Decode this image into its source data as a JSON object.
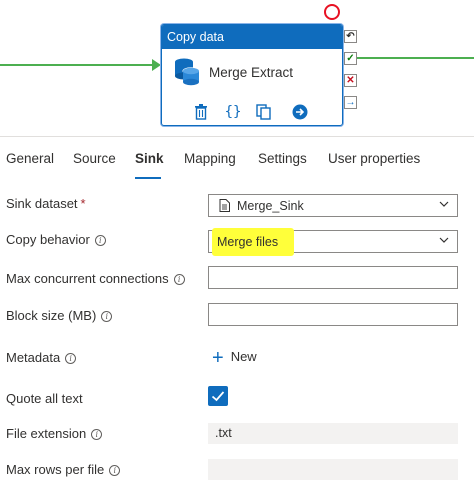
{
  "activity": {
    "type_label": "Copy data",
    "name": "Merge Extract",
    "action_icons": [
      "delete-icon",
      "code-icon",
      "copy-icon",
      "arrow-right-circle-icon"
    ],
    "side_icons": [
      "redo-icon",
      "success-check-icon",
      "failure-x-icon",
      "completion-arrow-icon"
    ]
  },
  "tabs": [
    {
      "label": "General",
      "active": false
    },
    {
      "label": "Source",
      "active": false
    },
    {
      "label": "Sink",
      "active": true
    },
    {
      "label": "Mapping",
      "active": false
    },
    {
      "label": "Settings",
      "active": false
    },
    {
      "label": "User properties",
      "active": false
    }
  ],
  "form": {
    "sink_dataset": {
      "label": "Sink dataset",
      "required_mark": "*",
      "value": "Merge_Sink"
    },
    "copy_behavior": {
      "label": "Copy behavior",
      "value": "Merge files"
    },
    "max_concurrent": {
      "label": "Max concurrent connections",
      "value": ""
    },
    "block_size": {
      "label": "Block size (MB)",
      "value": ""
    },
    "metadata": {
      "label": "Metadata",
      "new_label": "New"
    },
    "quote_all_text": {
      "label": "Quote all text",
      "checked": true
    },
    "file_extension": {
      "label": "File extension",
      "value": ".txt"
    },
    "max_rows": {
      "label": "Max rows per file",
      "value": ""
    }
  },
  "colors": {
    "accent": "#0f6cbd",
    "success_wire": "#4caf50",
    "highlight": "#ffff3a",
    "breakpoint": "#e81123"
  }
}
